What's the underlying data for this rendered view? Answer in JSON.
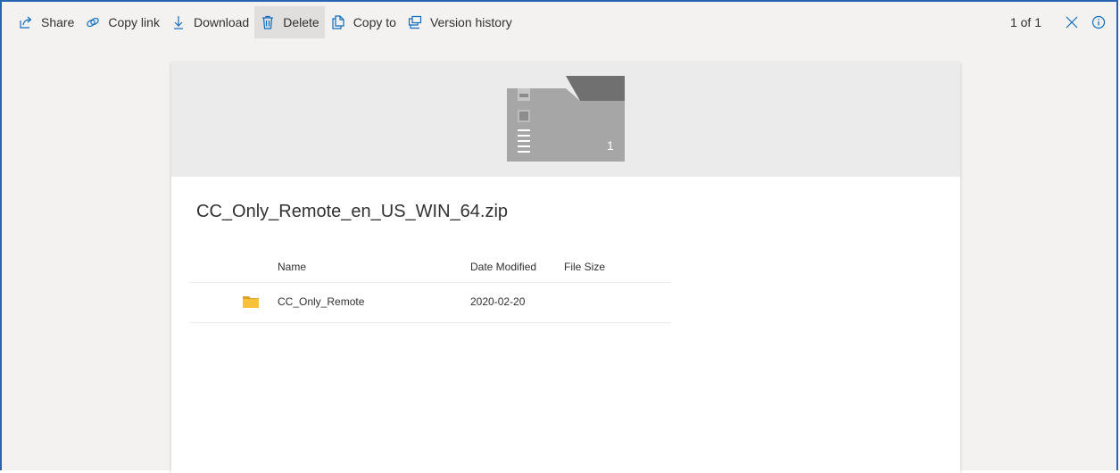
{
  "toolbar": {
    "share_label": "Share",
    "copy_link_label": "Copy link",
    "download_label": "Download",
    "delete_label": "Delete",
    "copy_to_label": "Copy to",
    "version_history_label": "Version history",
    "counter": "1 of 1",
    "icons": {
      "share": "share-icon",
      "copy_link": "link-icon",
      "download": "download-icon",
      "delete": "trash-icon",
      "copy_to": "copy-icon",
      "version_history": "version-history-icon",
      "close": "close-icon",
      "info": "info-icon"
    }
  },
  "preview": {
    "zip_count": "1",
    "file_name": "CC_Only_Remote_en_US_WIN_64.zip"
  },
  "table": {
    "columns": [
      "Name",
      "Date Modified",
      "File Size"
    ],
    "rows": [
      {
        "icon": "folder-icon",
        "name": "CC_Only_Remote",
        "date_modified": "2020-02-20",
        "file_size": ""
      }
    ]
  },
  "colors": {
    "accent": "#0f6cbd",
    "frame_border": "#2b63b4",
    "toolbar_bg": "#f3f2f1",
    "banner_bg": "#ebebeb",
    "folder": "#f7c23a"
  }
}
